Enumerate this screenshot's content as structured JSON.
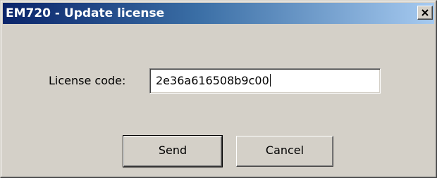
{
  "window": {
    "title": "EM720 - Update license",
    "close_icon": "close-icon"
  },
  "form": {
    "license_label": "License code:",
    "license_value": "2e36a616508b9c00"
  },
  "buttons": {
    "send_label": "Send",
    "cancel_label": "Cancel"
  },
  "colors": {
    "titlebar_start": "#0a246a",
    "titlebar_end": "#a6caf0",
    "dialog_background": "#d4d0c8"
  }
}
